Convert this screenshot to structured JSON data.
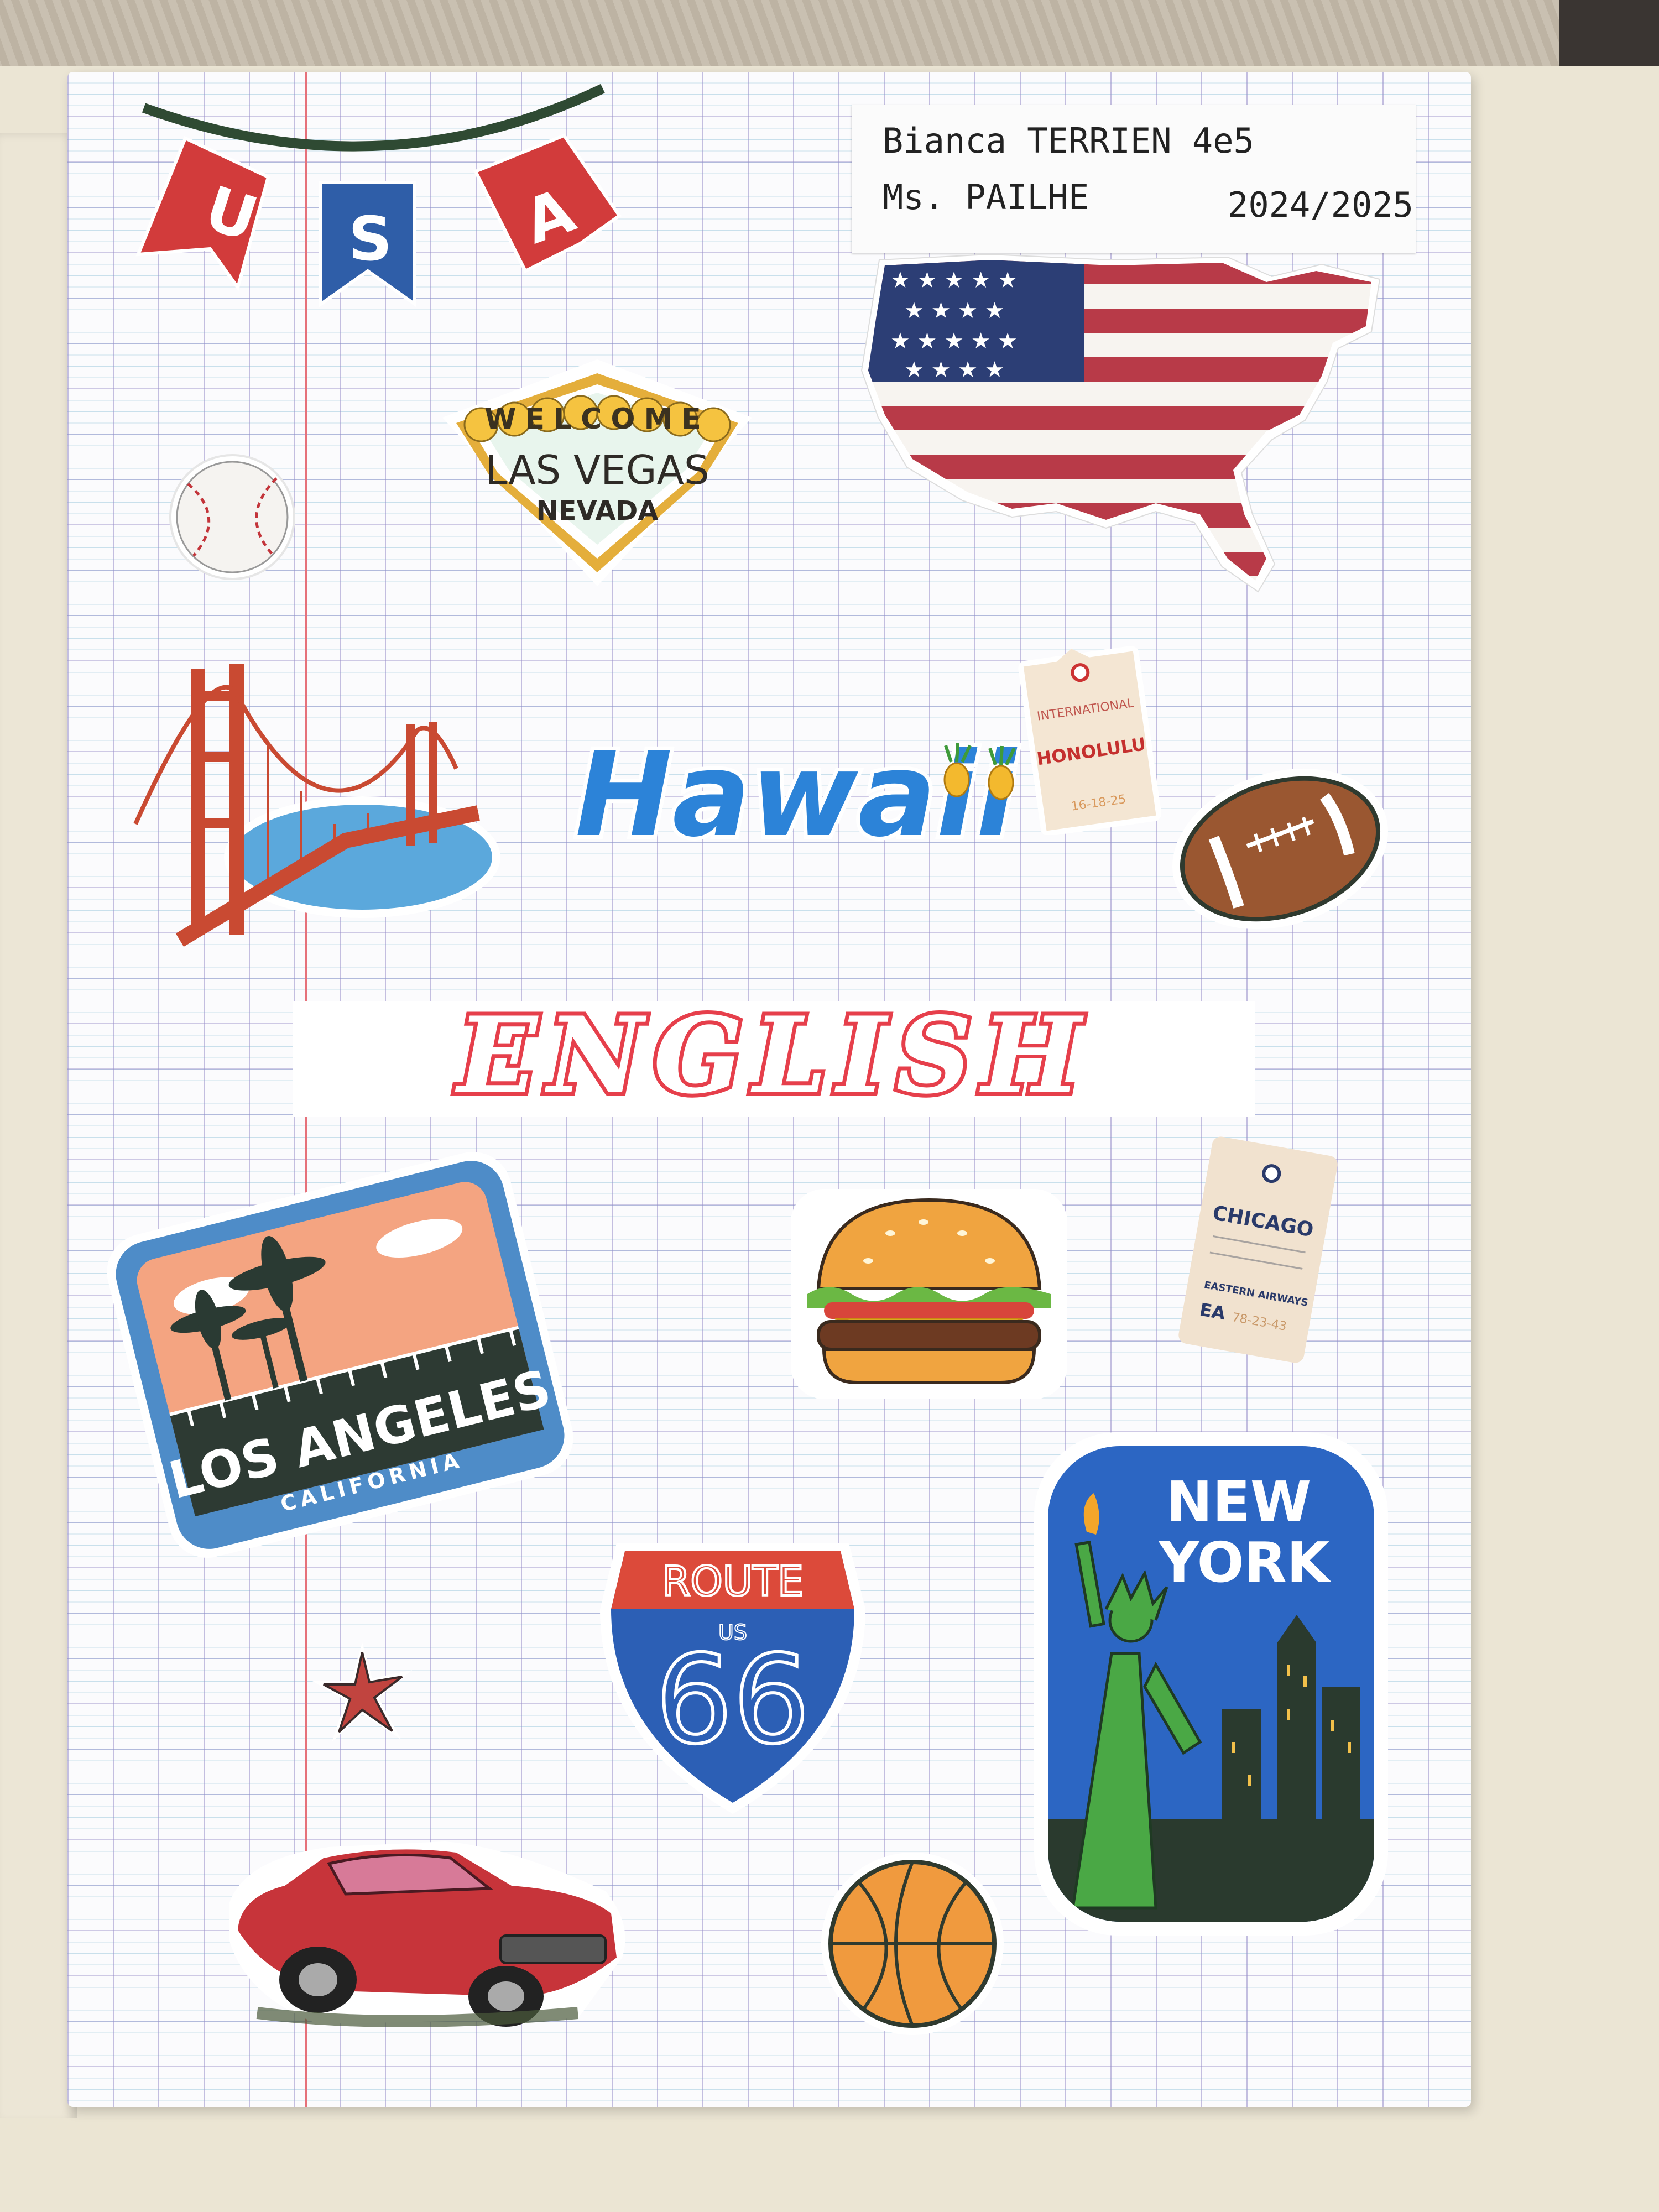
{
  "label": {
    "line1": "Bianca TERRIEN 4e5",
    "line2": "Ms. PAILHE",
    "year": "2024/2025"
  },
  "bunting": {
    "letters": [
      "U",
      "S",
      "A"
    ]
  },
  "vegas": {
    "top": "WELCOME",
    "middle": "LAS VEGAS",
    "bottom": "NEVADA"
  },
  "hawaii": {
    "text": "Hawaii"
  },
  "honolulu_tag": {
    "top": "INTERNATIONAL",
    "city": "HONOLULU",
    "date": "16-18-25"
  },
  "title": {
    "text": "ENGLISH"
  },
  "chicago_tag": {
    "city": "CHICAGO",
    "airline": "EASTERN AIRWAYS",
    "code": "EA",
    "date": "78-23-43"
  },
  "los_angeles": {
    "city": "LOS ANGELES",
    "state": "CALIFORNIA"
  },
  "route66": {
    "top": "ROUTE",
    "us": "US",
    "number": "66"
  },
  "new_york": {
    "line1": "NEW",
    "line2": "YORK"
  },
  "colors": {
    "red": "#d8393b",
    "blue": "#2f62b8",
    "paper": "#fbfbfd",
    "flag_red": "#b83a48",
    "flag_blue": "#2c3e75"
  }
}
